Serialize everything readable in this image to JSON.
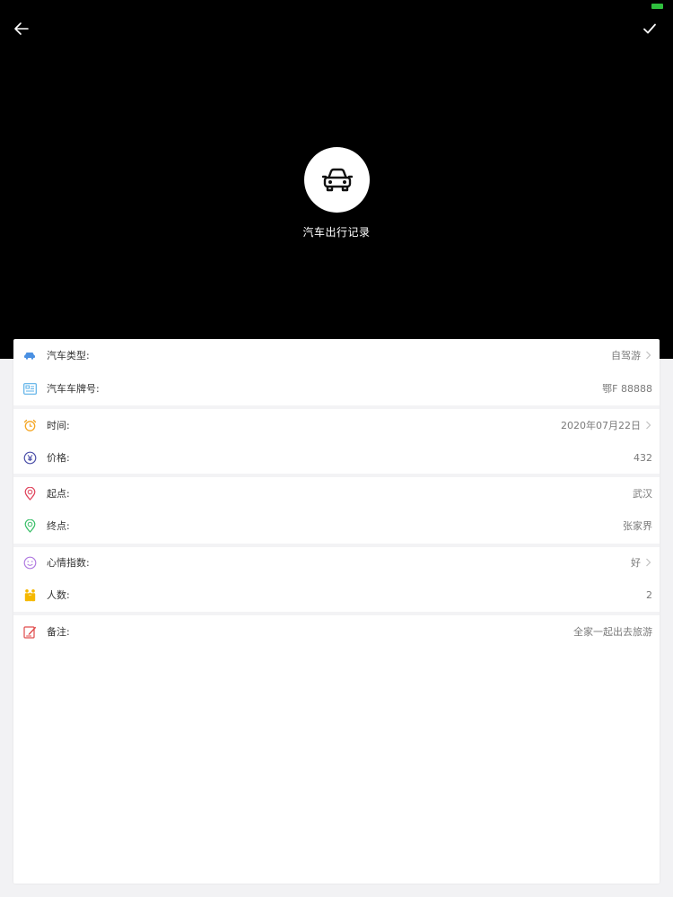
{
  "header": {
    "title": "汽车出行记录",
    "icons": {
      "back": "back-arrow-icon",
      "confirm": "checkmark-icon",
      "hero": "car-icon",
      "battery": "battery-icon"
    }
  },
  "form": {
    "groups": [
      [
        {
          "id": "car-type",
          "icon": "car-small-icon",
          "label": "汽车类型:",
          "value": "自驾游",
          "chevron": true
        },
        {
          "id": "plate",
          "icon": "license-plate-icon",
          "label": "汽车车牌号:",
          "value": "鄂F 88888",
          "chevron": false
        }
      ],
      [
        {
          "id": "time",
          "icon": "alarm-clock-icon",
          "label": "时间:",
          "value": "2020年07月22日",
          "chevron": true
        },
        {
          "id": "price",
          "icon": "yen-icon",
          "label": "价格:",
          "value": "432",
          "chevron": false
        }
      ],
      [
        {
          "id": "start",
          "icon": "start-pin-icon",
          "label": "起点:",
          "value": "武汉",
          "chevron": false
        },
        {
          "id": "end",
          "icon": "end-pin-icon",
          "label": "终点:",
          "value": "张家界",
          "chevron": false
        }
      ],
      [
        {
          "id": "mood",
          "icon": "smiley-icon",
          "label": "心情指数:",
          "value": "好",
          "chevron": true
        },
        {
          "id": "people",
          "icon": "people-icon",
          "label": "人数:",
          "value": "2",
          "chevron": false
        }
      ],
      [
        {
          "id": "note",
          "icon": "note-edit-icon",
          "label": "备注:",
          "value": "全家一起出去旅游",
          "chevron": false
        }
      ]
    ]
  },
  "colors": {
    "background": "#000000",
    "card": "#ffffff",
    "label": "#333333",
    "value": "#7a7a7a",
    "battery": "#2fbf3e"
  }
}
